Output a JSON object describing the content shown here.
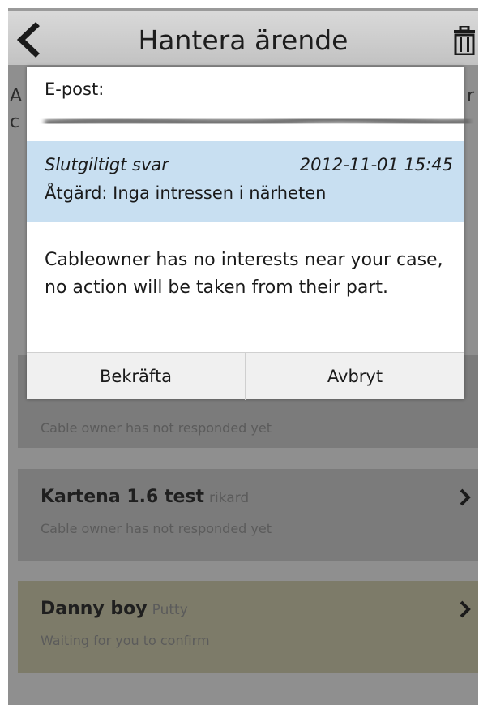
{
  "header": {
    "title": "Hantera ärende",
    "back_icon": "chevron-left-icon",
    "delete_icon": "trash-icon"
  },
  "dialog": {
    "email_label": "E-post:",
    "answer_type": "Slutgiltigt svar",
    "answer_date": "2012-11-01 15:45",
    "answer_action": "Åtgärd: Inga intressen i närheten",
    "message": "Cableowner has no interests near your case, no action will be taken from their part.",
    "confirm_label": "Bekräfta",
    "cancel_label": "Avbryt"
  },
  "background": {
    "left_letter_1": "A",
    "left_letter_2": "c",
    "right_letter": "r",
    "cards": [
      {
        "title": "",
        "user": "",
        "status": "Cable owner has not responded yet"
      },
      {
        "title": "Kartena 1.6 test",
        "user": "rikard",
        "status": "Cable owner has not responded yet"
      },
      {
        "title": "Danny boy",
        "user": "Putty",
        "status": "Waiting for you to confirm"
      }
    ]
  },
  "colors": {
    "answer_highlight": "#c8dff1",
    "overlay": "#8f8f8f",
    "waiting_card": "#7d7b69"
  }
}
